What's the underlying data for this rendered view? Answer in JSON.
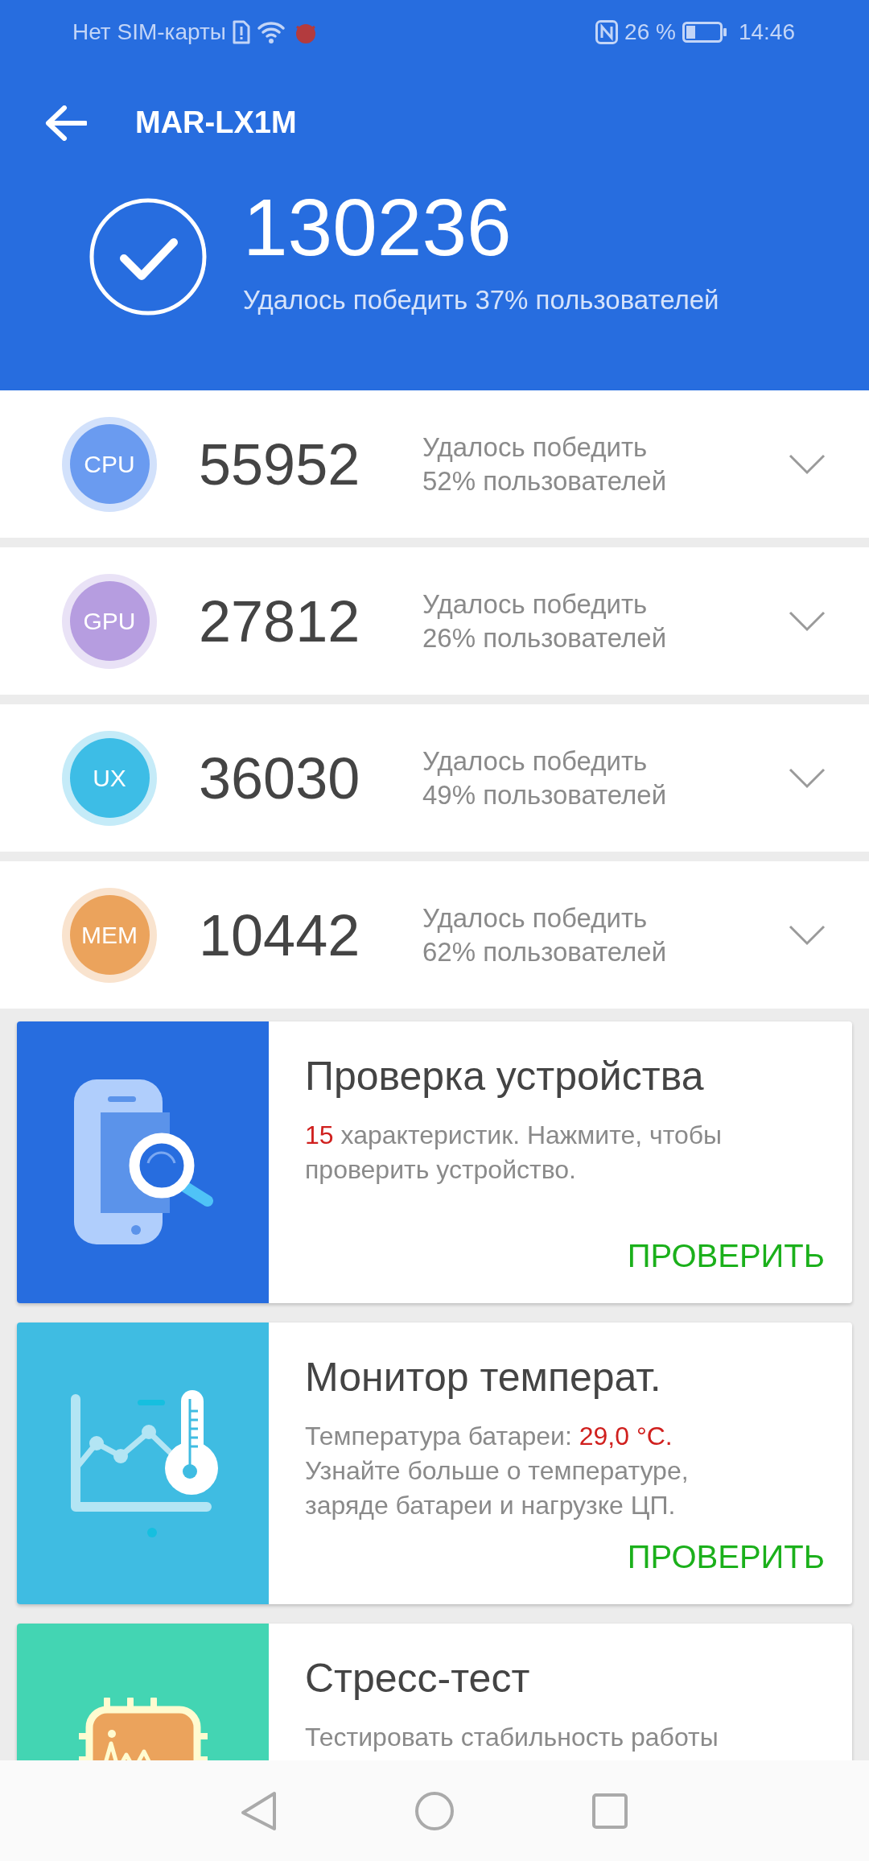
{
  "status_bar": {
    "carrier": "Нет SIM-карты",
    "battery": "26 %",
    "time": "14:46"
  },
  "header": {
    "title": "MAR-LX1M",
    "total_score": "130236",
    "subtitle": "Удалось победить 37% пользователей"
  },
  "scores": [
    {
      "label": "CPU",
      "score": "55952",
      "line_1": "Удалось победить",
      "line_2": "52% пользователей",
      "color": "#6a9bf0",
      "expanded": false
    },
    {
      "label": "GPU",
      "score": "27812",
      "line_1": "Удалось победить",
      "line_2": "26% пользователей",
      "color": "#b69de0",
      "expanded": false
    },
    {
      "label": "UX",
      "score": "36030",
      "line_1": "Удалось победить",
      "line_2": "49% пользователей",
      "color": "#3dbde6",
      "expanded": false
    },
    {
      "label": "MEM",
      "score": "10442",
      "line_1": "Удалось победить",
      "line_2": "62% пользователей",
      "color": "#eba35c",
      "expanded": false
    }
  ],
  "cards": [
    {
      "kind": "device",
      "color": "#276ddf",
      "title": "Проверка устройства",
      "description": [
        {
          "text": "15",
          "highlight": true
        },
        {
          "text": " характеристик. Нажмите, чтобы проверить устройство.",
          "highlight": false
        }
      ],
      "action": "ПРОВЕРИТЬ"
    },
    {
      "kind": "temperature",
      "color": "#3fbce2",
      "title": "Монитор температ.",
      "description": [
        {
          "text": "Температура батареи: ",
          "highlight": false
        },
        {
          "text": "29,0 °C.",
          "highlight": true
        },
        {
          "text": " Узнайте больше о температуре, заряде батареи и нагрузке ЦП.",
          "highlight": false
        }
      ],
      "action": "ПРОВЕРИТЬ"
    },
    {
      "kind": "stress",
      "color": "#43d5b3",
      "title": "Стресс-тест",
      "description": [
        {
          "text": "Тестировать стабильность работы",
          "highlight": false
        }
      ]
    }
  ]
}
